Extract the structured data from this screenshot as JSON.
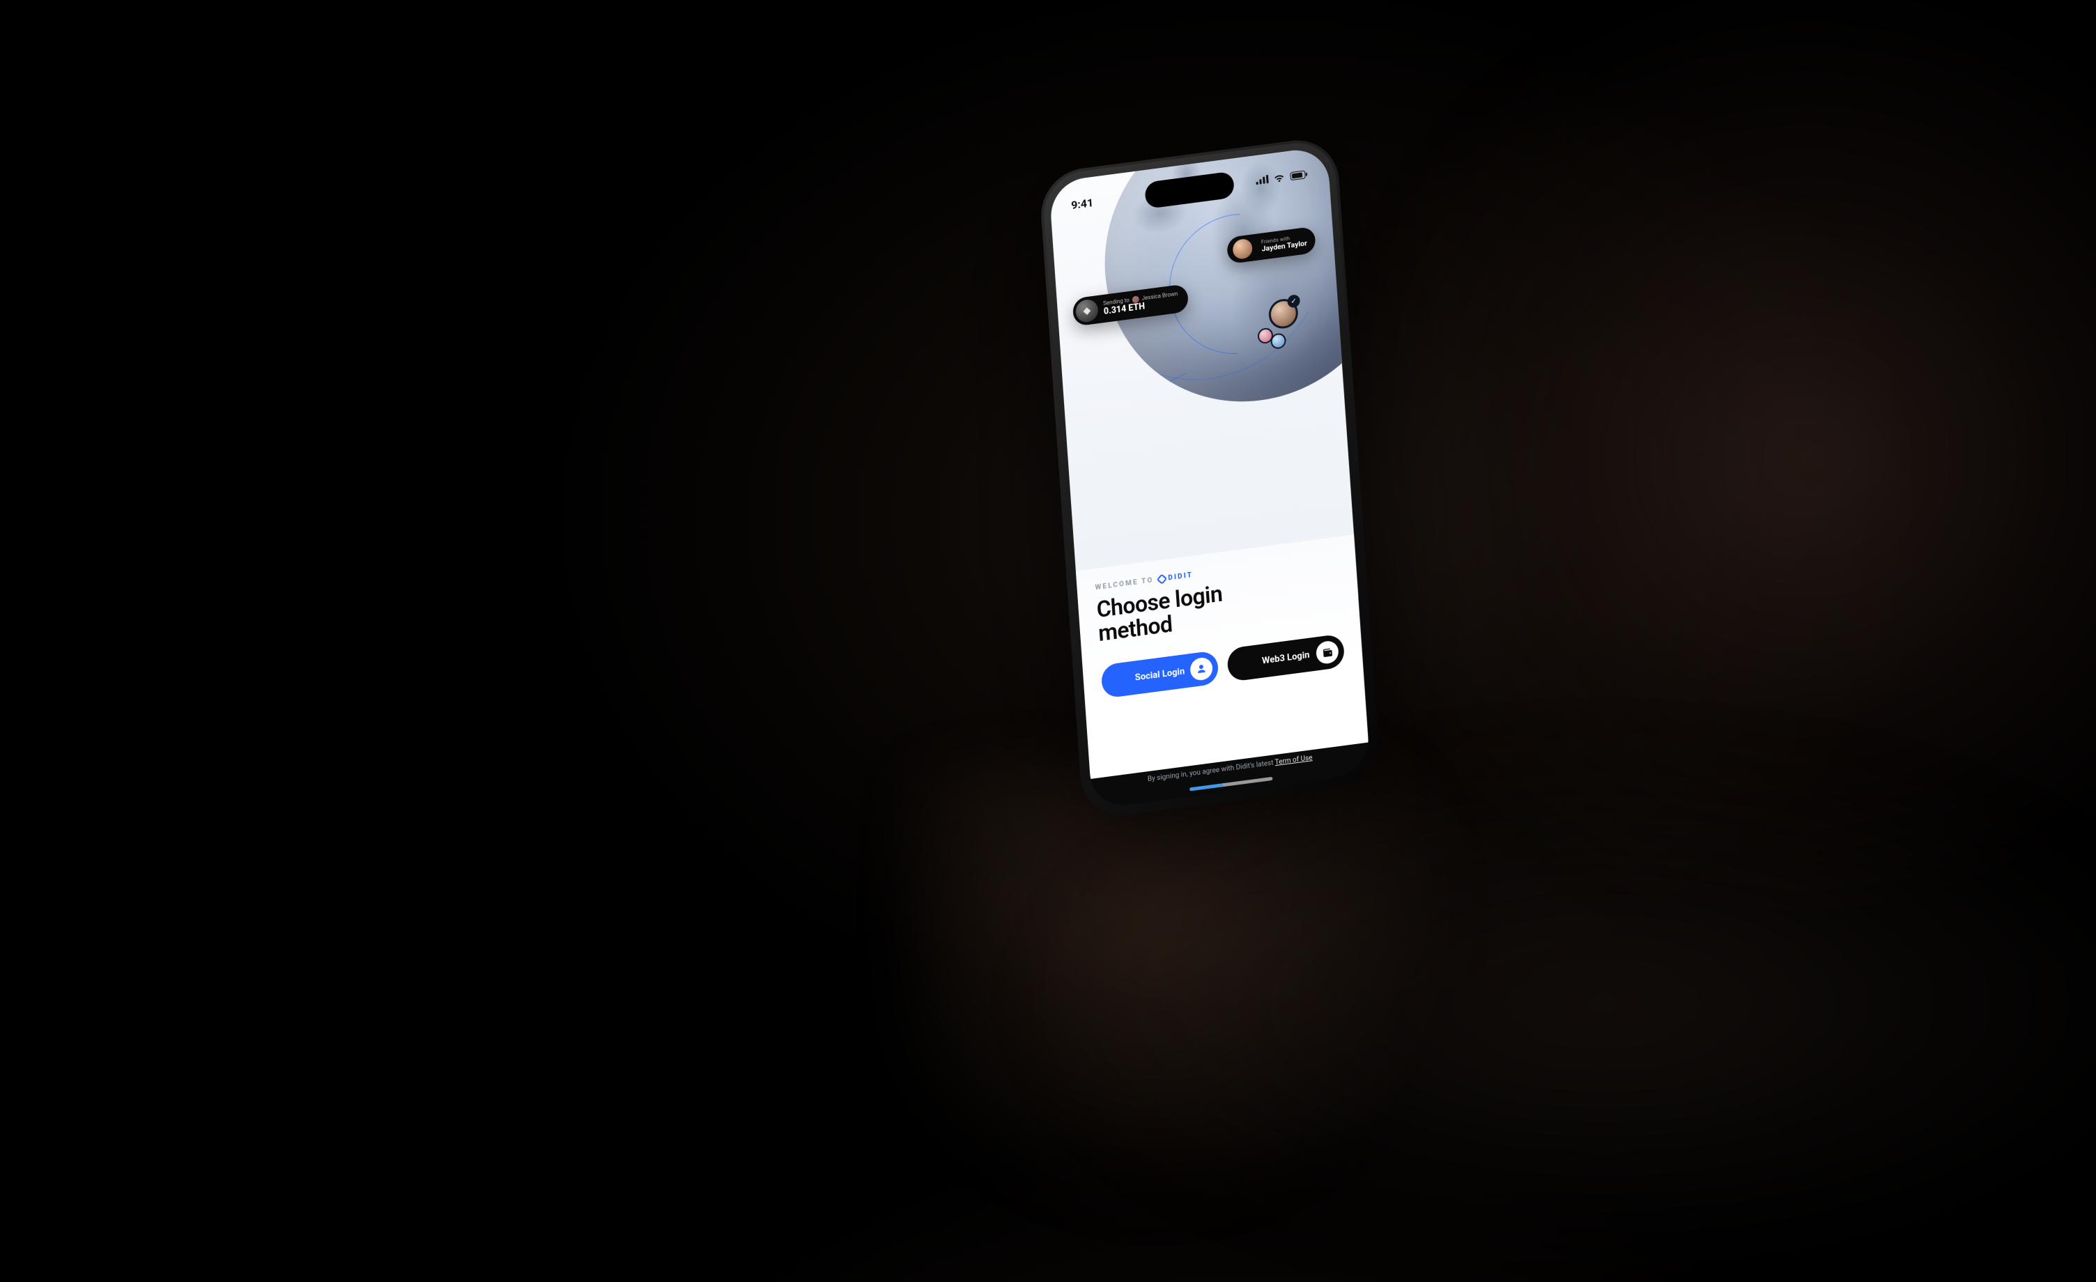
{
  "status": {
    "time": "9:41"
  },
  "overlays": {
    "sending": {
      "kicker_prefix": "Sending to",
      "recipient": "Jessica Brown",
      "amount": "0.314 ETH",
      "coin_glyph": "◆"
    },
    "friend": {
      "kicker": "Friends with",
      "name": "Jayden Taylor"
    },
    "cluster_check_glyph": "✓"
  },
  "eyebrow": {
    "prefix": "WELCOME TO",
    "brand": "DIDIT"
  },
  "headline_line1": "Choose login",
  "headline_line2": "method",
  "buttons": {
    "social": "Social Login",
    "web3": "Web3 Login"
  },
  "terms": {
    "prefix": "By signing in, you agree with Didit's latest ",
    "link": "Term of Use"
  },
  "colors": {
    "accent": "#2563ff"
  }
}
